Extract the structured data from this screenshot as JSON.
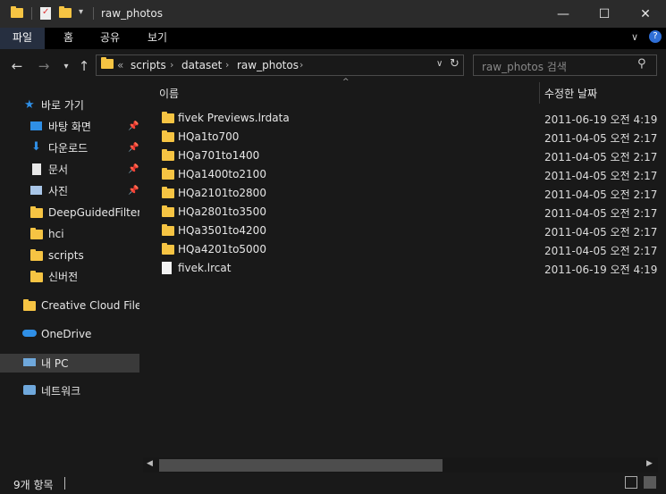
{
  "window": {
    "title": "raw_photos"
  },
  "ribbon": {
    "tabs": [
      "파일",
      "홈",
      "공유",
      "보기"
    ]
  },
  "address": {
    "breadcrumb": [
      "scripts",
      "dataset",
      "raw_photos"
    ],
    "overflow": "«"
  },
  "search": {
    "placeholder": "raw_photos 검색"
  },
  "nav": {
    "quick_access": "바로 가기",
    "quick_items": [
      {
        "label": "바탕 화면",
        "icon": "desktop-icon",
        "pinned": true
      },
      {
        "label": "다운로드",
        "icon": "download-icon",
        "pinned": true
      },
      {
        "label": "문서",
        "icon": "document-icon",
        "pinned": true
      },
      {
        "label": "사진",
        "icon": "pictures-icon",
        "pinned": true
      },
      {
        "label": "DeepGuidedFilterin",
        "icon": "folder-icon",
        "pinned": false
      },
      {
        "label": "hci",
        "icon": "folder-icon",
        "pinned": false
      },
      {
        "label": "scripts",
        "icon": "folder-icon",
        "pinned": false
      },
      {
        "label": "신버전",
        "icon": "folder-icon",
        "pinned": false
      }
    ],
    "creative_cloud": "Creative Cloud Files",
    "onedrive": "OneDrive",
    "this_pc": "내 PC",
    "network": "네트워크"
  },
  "columns": {
    "name": "이름",
    "date": "수정한 날짜"
  },
  "files": [
    {
      "name": "fivek Previews.lrdata",
      "date": "2011-06-19 오전 4:19",
      "type": "folder"
    },
    {
      "name": "HQa1to700",
      "date": "2011-04-05 오전 2:17",
      "type": "folder"
    },
    {
      "name": "HQa701to1400",
      "date": "2011-04-05 오전 2:17",
      "type": "folder"
    },
    {
      "name": "HQa1400to2100",
      "date": "2011-04-05 오전 2:17",
      "type": "folder"
    },
    {
      "name": "HQa2101to2800",
      "date": "2011-04-05 오전 2:17",
      "type": "folder"
    },
    {
      "name": "HQa2801to3500",
      "date": "2011-04-05 오전 2:17",
      "type": "folder"
    },
    {
      "name": "HQa3501to4200",
      "date": "2011-04-05 오전 2:17",
      "type": "folder"
    },
    {
      "name": "HQa4201to5000",
      "date": "2011-04-05 오전 2:17",
      "type": "folder"
    },
    {
      "name": "fivek.lrcat",
      "date": "2011-06-19 오전 4:19",
      "type": "file"
    }
  ],
  "status": {
    "item_count": "9개 항목"
  },
  "colors": {
    "folder": "#f6c443",
    "accent": "#262f40",
    "selected": "#3a3a3a"
  }
}
